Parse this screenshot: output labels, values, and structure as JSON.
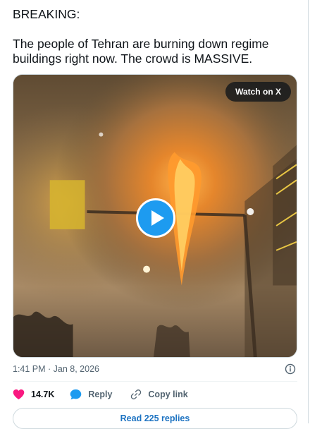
{
  "post": {
    "line1": "BREAKING:",
    "line2": "The people of Tehran are burning down regime buildings right now. The crowd is MASSIVE."
  },
  "media": {
    "watch_label": "Watch on X",
    "play_icon": "play-icon"
  },
  "meta": {
    "timestamp": "1:41 PM · Jan 8, 2026",
    "info_icon": "info-icon"
  },
  "actions": {
    "likes": "14.7K",
    "reply_label": "Reply",
    "copy_label": "Copy link",
    "like_icon": "heart-icon",
    "reply_icon": "speech-bubble-icon",
    "copy_icon": "link-icon"
  },
  "replies": {
    "label": "Read 225 replies"
  },
  "colors": {
    "accent": "#1d9bf0",
    "like": "#f91880",
    "link_text": "#1d73c2",
    "muted": "#536471"
  }
}
